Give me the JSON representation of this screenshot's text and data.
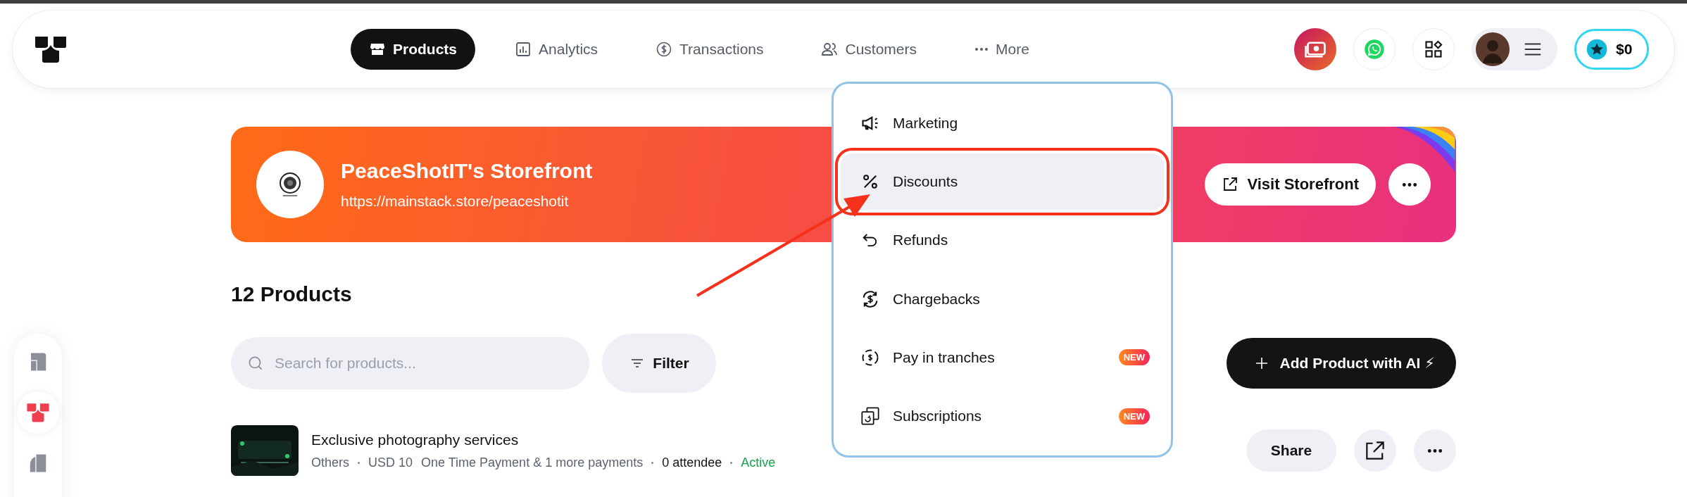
{
  "nav": {
    "tabs": [
      {
        "label": "Products",
        "selected": true
      },
      {
        "label": "Analytics",
        "selected": false
      },
      {
        "label": "Transactions",
        "selected": false
      },
      {
        "label": "Customers",
        "selected": false
      },
      {
        "label": "More",
        "selected": false
      }
    ],
    "balance": "$0"
  },
  "more_menu": {
    "items": [
      {
        "label": "Marketing",
        "selected": false,
        "annotated": false
      },
      {
        "label": "Discounts",
        "selected": true,
        "annotated": true
      },
      {
        "label": "Refunds",
        "selected": false,
        "annotated": false
      },
      {
        "label": "Chargebacks",
        "selected": false,
        "annotated": false
      },
      {
        "label": "Pay in tranches",
        "selected": false,
        "annotated": false,
        "badge": "NEW"
      },
      {
        "label": "Subscriptions",
        "selected": false,
        "annotated": false,
        "badge": "NEW"
      }
    ]
  },
  "storefront": {
    "title": "PeaceShotIT's Storefront",
    "url": "https://mainstack.store/peaceshotit",
    "visit_button": "Visit Storefront"
  },
  "sidebar": {
    "items": [
      {
        "selected": false
      },
      {
        "selected": true
      },
      {
        "selected": false
      }
    ]
  },
  "products_heading": "12 Products",
  "search": {
    "placeholder": "Search for products..."
  },
  "filter_button": "Filter",
  "add_button": "Add Product with AI ⚡",
  "products": [
    {
      "title": "Exclusive photography services",
      "category": "Others",
      "price": "USD 10",
      "payment": "One Time Payment & 1 more payments",
      "attendees": "0 attendee",
      "status": "Active",
      "share_button": "Share"
    }
  ]
}
